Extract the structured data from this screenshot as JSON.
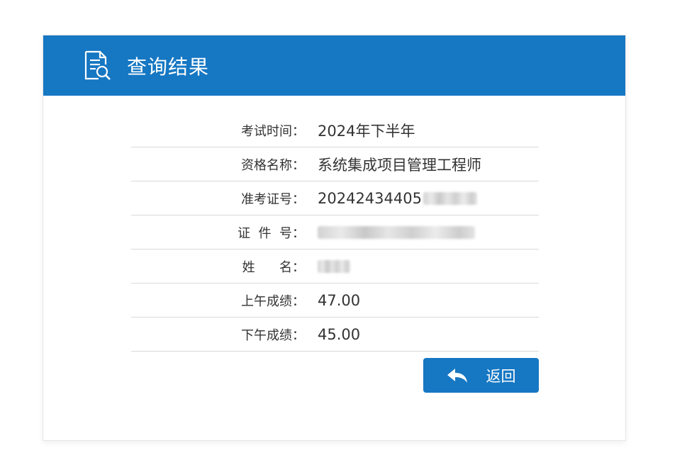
{
  "header": {
    "title": "查询结果",
    "icon": "document-search-icon"
  },
  "rows": [
    {
      "label": "考试时间：",
      "value": "2024年下半年"
    },
    {
      "label": "资格名称：",
      "value": "系统集成项目管理工程师"
    },
    {
      "label": "准考证号：",
      "value": "20242434405"
    },
    {
      "label": "证  件  号：",
      "value": ""
    },
    {
      "label": "姓      名：",
      "value": ""
    },
    {
      "label": "上午成绩：",
      "value": "47.00"
    },
    {
      "label": "下午成绩：",
      "value": "45.00"
    }
  ],
  "back_button": {
    "label": "返回",
    "icon": "reply-arrow-icon"
  },
  "colors": {
    "accent": "#1677c3",
    "text": "#333333",
    "divider": "#d9d9d9"
  }
}
